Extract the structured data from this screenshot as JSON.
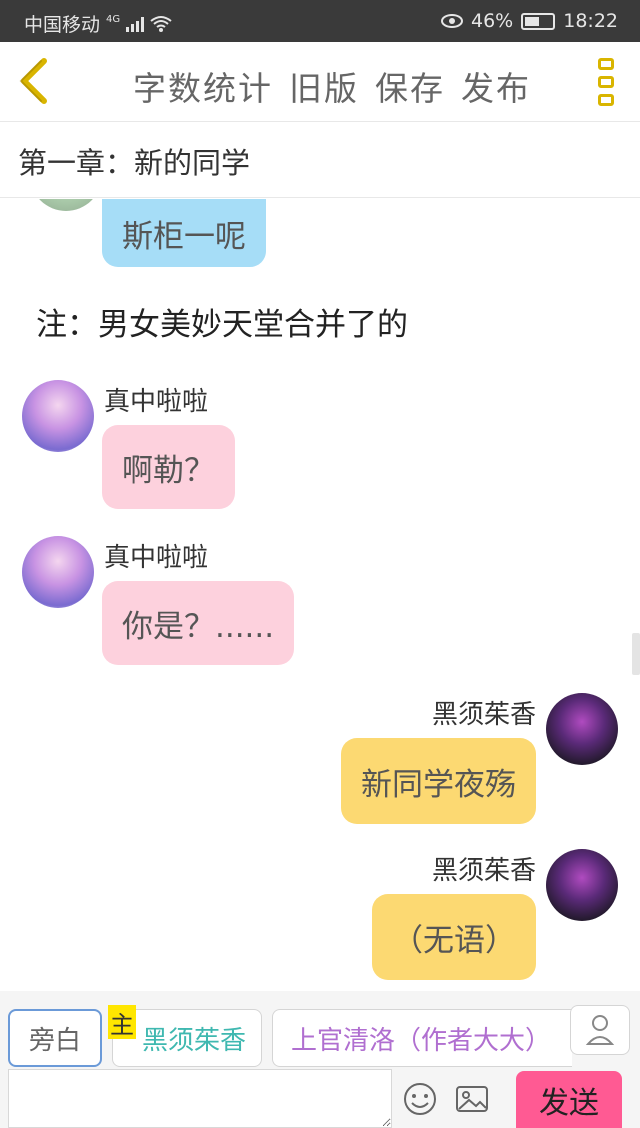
{
  "status": {
    "carrier": "中国移动",
    "net": "4G",
    "battery": "46%",
    "time": "18:22"
  },
  "header": {
    "back_icon": "chevron-left-icon",
    "buttons": [
      "字数统计",
      "旧版",
      "保存",
      "发布"
    ],
    "menu_icon": "more-vertical-icon"
  },
  "chapter": {
    "title": "第一章：新的同学"
  },
  "chat": {
    "first_bubble": "斯柜一呢",
    "note": "注：男女美妙天堂合并了的",
    "messages": [
      {
        "name": "真中啦啦",
        "text": "啊勒？",
        "side": "left",
        "color": "#fdd1dd"
      },
      {
        "name": "真中啦啦",
        "text": "你是？......",
        "side": "left",
        "color": "#fdd1dd"
      },
      {
        "name": "黑须茱香",
        "text": "新同学夜殇",
        "side": "right",
        "color": "#fcd972"
      },
      {
        "name": "黑须茱香",
        "text": "（无语）",
        "side": "right",
        "color": "#fcd972"
      }
    ]
  },
  "roles": {
    "narrator": "旁白",
    "main_tag": "主",
    "role1": "黑须茱香",
    "role2": "上官清洛（作者大大）",
    "add_role_icon": "person-icon"
  },
  "input": {
    "placeholder": "",
    "send_label": "发送",
    "emoji_icon": "emoji-icon",
    "image_icon": "image-icon"
  },
  "colors": {
    "accent": "#d9b500",
    "send": "#ff5a93",
    "role1_text": "#3fb8b0",
    "role2_text": "#b06fd0"
  }
}
